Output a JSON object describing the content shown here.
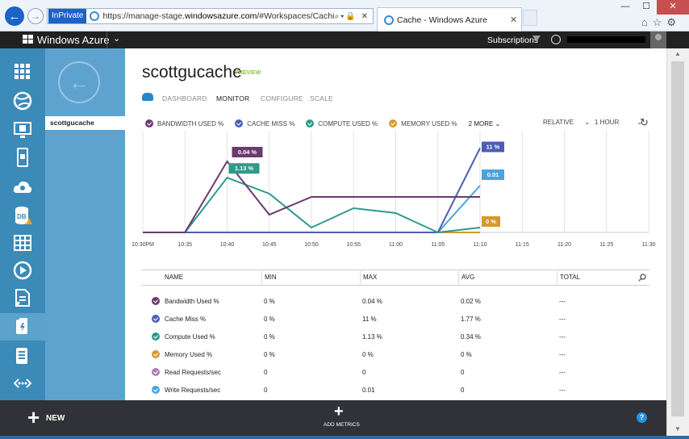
{
  "browser": {
    "inprivate_label": "InPrivate",
    "url_prefix": "https://manage-stage.",
    "url_domain": "windowsazure.com",
    "url_suffix": "/#Workspaces/CachingExtension/Cachi",
    "tab_title": "Cache - Windows Azure"
  },
  "topbar": {
    "brand": "Windows Azure",
    "subscriptions_label": "Subscriptions"
  },
  "drawer": {
    "item_label": "scottgucache"
  },
  "page": {
    "title": "scottgucache",
    "badge": "PREVIEW",
    "tabs": [
      "DASHBOARD",
      "MONITOR",
      "CONFIGURE",
      "SCALE"
    ],
    "active_tab": "MONITOR"
  },
  "legend": {
    "items": [
      {
        "label": "BANDWIDTH USED %",
        "color": "#6b3a6e"
      },
      {
        "label": "CACHE MISS %",
        "color": "#4c5eb4"
      },
      {
        "label": "COMPUTE USED %",
        "color": "#2e9a8a"
      },
      {
        "label": "MEMORY USED %",
        "color": "#d49a2e"
      }
    ],
    "more_label": "2 MORE",
    "range_label": "RELATIVE",
    "timespan_label": "1 HOUR"
  },
  "chart_data": {
    "type": "line",
    "x": [
      "10:30PM",
      "10:35",
      "10:40",
      "10:45",
      "10:50",
      "10:55",
      "11:00",
      "11:05",
      "11:10",
      "11:15",
      "11:20",
      "11:25",
      "11:30"
    ],
    "series": [
      {
        "name": "Bandwidth Used %",
        "color": "#6b3a6e",
        "values": [
          0,
          0,
          0.04,
          0.01,
          0.02,
          0.02,
          0.02,
          0.02,
          0.02
        ],
        "label": "0.04 %"
      },
      {
        "name": "Compute Used %",
        "color": "#2e9a8a",
        "values": [
          0,
          0,
          1.13,
          0.8,
          0.1,
          0.5,
          0.4,
          0,
          0.1
        ],
        "label": "1.13 %"
      },
      {
        "name": "Cache Miss %",
        "color": "#4c5eb4",
        "values": [
          0,
          0,
          0,
          0,
          0,
          0,
          0,
          0,
          11
        ],
        "label": "11 %"
      },
      {
        "name": "Write Requests/sec",
        "color": "#4aa3e0",
        "values": [
          0,
          0,
          0,
          0,
          0,
          0,
          0,
          0,
          0.01
        ],
        "label": "0.01"
      },
      {
        "name": "Memory Used %",
        "color": "#d49a2e",
        "values": [
          0,
          0,
          0,
          0,
          0,
          0,
          0,
          0,
          0
        ],
        "label": "0 %"
      }
    ]
  },
  "table": {
    "headers": [
      "NAME",
      "MIN",
      "MAX",
      "AVG",
      "TOTAL"
    ],
    "rows": [
      {
        "name": "Bandwidth Used %",
        "min": "0 %",
        "max": "0.04 %",
        "avg": "0.02 %",
        "total": "---",
        "color": "#6b3a6e"
      },
      {
        "name": "Cache Miss %",
        "min": "0 %",
        "max": "11 %",
        "avg": "1.77 %",
        "total": "---",
        "color": "#4c5eb4"
      },
      {
        "name": "Compute Used %",
        "min": "0 %",
        "max": "1.13 %",
        "avg": "0.34 %",
        "total": "---",
        "color": "#2e9a8a"
      },
      {
        "name": "Memory Used %",
        "min": "0 %",
        "max": "0 %",
        "avg": "0 %",
        "total": "---",
        "color": "#d49a2e"
      },
      {
        "name": "Read Requests/sec",
        "min": "0",
        "max": "0",
        "avg": "0",
        "total": "---",
        "color": "#b07fb3"
      },
      {
        "name": "Write Requests/sec",
        "min": "0",
        "max": "0.01",
        "avg": "0",
        "total": "---",
        "color": "#4aa3e0"
      }
    ]
  },
  "bottombar": {
    "new_label": "NEW",
    "add_metrics_label": "ADD METRICS",
    "help_label": "?"
  }
}
